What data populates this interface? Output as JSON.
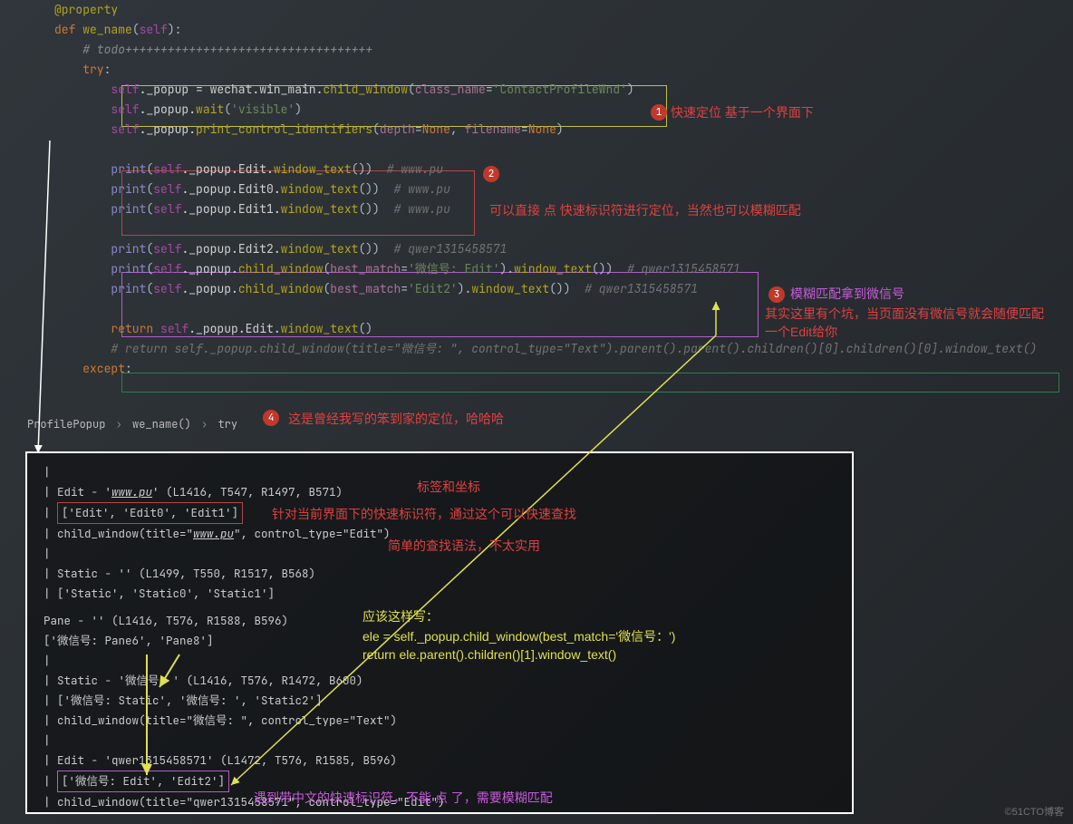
{
  "code": {
    "l1": "@property",
    "l2a": "def",
    "l2b": " we_name",
    "l2c": "(",
    "l2d": "self",
    "l2e": "):",
    "l3": "# todo+++++++++++++++++++++++++++++++++++",
    "l4": "try:",
    "l5": "self._popup = wechat.win_main.child_window(class_name='ContactProfileWnd')",
    "l6": "self._popup.wait('visible')",
    "l7": "self._popup.print_control_identifiers(depth=None, filename=None)",
    "l8": "print(self._popup.Edit.window_text())  # www.pu",
    "l9": "print(self._popup.Edit0.window_text())  # www.pu",
    "l10": "print(self._popup.Edit1.window_text())  # www.pu",
    "l11": "print(self._popup.Edit2.window_text())  # qwer1315458571",
    "l12": "print(self._popup.child_window(best_match='微信号: Edit').window_text())  # qwer1315458571",
    "l13": "print(self._popup.child_window(best_match='Edit2').window_text())  # qwer1315458571",
    "l14": "return self._popup.Edit.window_text()",
    "l15": "# return self._popup.child_window(title=\"微信号: \", control_type=\"Text\").parent().parent().children()[0].children()[0].window_text()",
    "l16": "except:"
  },
  "annos": {
    "a1": "快速定位 基于一个界面下",
    "a2": "可以直接 点 快速标识符进行定位，当然也可以模糊匹配",
    "a3a": "模糊匹配拿到微信号",
    "a3b": "其实这里有个坑，当页面没有微信号就会随便匹配一个Edit给你",
    "a4": "这是曾经我写的笨到家的定位，哈哈哈",
    "c_label": "标签和坐标",
    "c_fast": "针对当前界面下的快速标识符，通过这个可以快速查找",
    "c_simple": "简单的查找语法，不太实用",
    "y1": "应该这样写：",
    "y2": "ele = self._popup.child_window(best_match='微信号：')",
    "y3": "return ele.parent().children()[1].window_text()",
    "c_cn": "遇到带中文的快速标识符，不能 点 了，需要模糊匹配"
  },
  "breadcrumbs": {
    "a": "ProfilePopup",
    "b": "we_name()",
    "c": "try"
  },
  "console": {
    "r1": "   |",
    "r2a": "   | Edit - '",
    "r2b": "www.pu",
    "r2c": "'    (L1416, T547, R1497, B571)",
    "r3": "['Edit', 'Edit0', 'Edit1']",
    "r4a": "   | child_window(title=\"",
    "r4b": "www.pu",
    "r4c": "\", control_type=\"Edit\")",
    "r5": "   |",
    "r6": "   | Static - ''    (L1499, T550, R1517, B568)",
    "r7": "   | ['Static', 'Static0', 'Static1']",
    "r8": "Pane - ''    (L1416, T576, R1588, B596)",
    "r9": "['微信号: Pane6', 'Pane8']",
    "r10": "   |",
    "r11": "   | Static - '微信号: '    (L1416, T576, R1472, B600)",
    "r12": "   | ['微信号: Static', '微信号: ', 'Static2']",
    "r13": "   | child_window(title=\"微信号: \", control_type=\"Text\")",
    "r14": "   |",
    "r15": "   | Edit - 'qwer1315458571'    (L1472, T576, R1585, B596)",
    "r16": "['微信号: Edit', 'Edit2']",
    "r17": "   | child_window(title=\"qwer1315458571\", control_type=\"Edit\")"
  },
  "badges": {
    "b1": "1",
    "b2": "2",
    "b3": "3",
    "b4": "4"
  },
  "watermark": "©51CTO博客"
}
